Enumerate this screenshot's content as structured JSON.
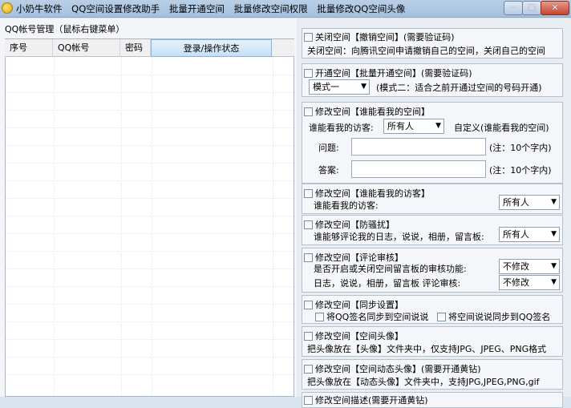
{
  "window": {
    "menu_items": [
      "小奶牛软件",
      "QQ空间设置修改助手",
      "批量开通空间",
      "批量修改空间权限",
      "批量修改QQ空间头像"
    ],
    "minimize_glyph": "─",
    "maximize_glyph": "□",
    "close_glyph": "✕"
  },
  "accounts": {
    "title": "QQ帐号管理（鼠标右键菜单）",
    "columns": [
      "序号",
      "QQ帐号",
      "密码",
      "登录/操作状态"
    ]
  },
  "sections": {
    "close_space": {
      "checkbox_label": "关闭空间【撤销空间】(需要验证码)",
      "desc": "关闭空间：向腾讯空间申请撤销自己的空间，关闭自己的空间"
    },
    "open_space": {
      "checkbox_label": "开通空间【批量开通空间】(需要验证码)",
      "mode_value": "模式一",
      "mode_note": "(模式二：适合之前开通过空间的号码开通)"
    },
    "who_can_see_space": {
      "checkbox_label": "修改空间【谁能看我的空间】",
      "visitors_label": "谁能看我的访客:",
      "visitors_value": "所有人",
      "custom_label": "自定义(谁能看我的空间)",
      "question_label": "问题:",
      "question_value": "",
      "question_note": "(注：10个字内)",
      "answer_label": "答案:",
      "answer_value": "",
      "answer_note": "(注：10个字内)"
    },
    "who_can_see_visitors": {
      "checkbox_label": "修改空间【谁能看我的访客】",
      "label": "谁能看我的访客:",
      "value": "所有人"
    },
    "anti_harass": {
      "checkbox_label": "修改空间【防骚扰】",
      "label": "谁能够评论我的日志，说说，相册，留言板:",
      "value": "所有人"
    },
    "comment_review": {
      "checkbox_label": "修改空间【评论审核】",
      "label1": "是否开启或关闭空间留言板的审核功能:",
      "value1": "不修改",
      "label2": "日志，说说，相册，留言板 评论审核:",
      "value2": "不修改"
    },
    "sync": {
      "checkbox_label": "修改空间【同步设置】",
      "option1": "将QQ签名同步到空间说说",
      "option2": "将空间说说同步到QQ签名"
    },
    "avatar": {
      "checkbox_label": "修改空间【空间头像】",
      "desc": "把头像放在【头像】文件夹中，仅支持JPG、JPEG、PNG格式"
    },
    "animated_avatar": {
      "checkbox_label": "修改空间【空间动态头像】(需要开通黄钻)",
      "desc": "把头像放在【动态头像】文件夹中，支持JPG,JPEG,PNG,gif"
    },
    "description": {
      "checkbox_label": "修改空间描述(需要开通黄钻)"
    }
  }
}
